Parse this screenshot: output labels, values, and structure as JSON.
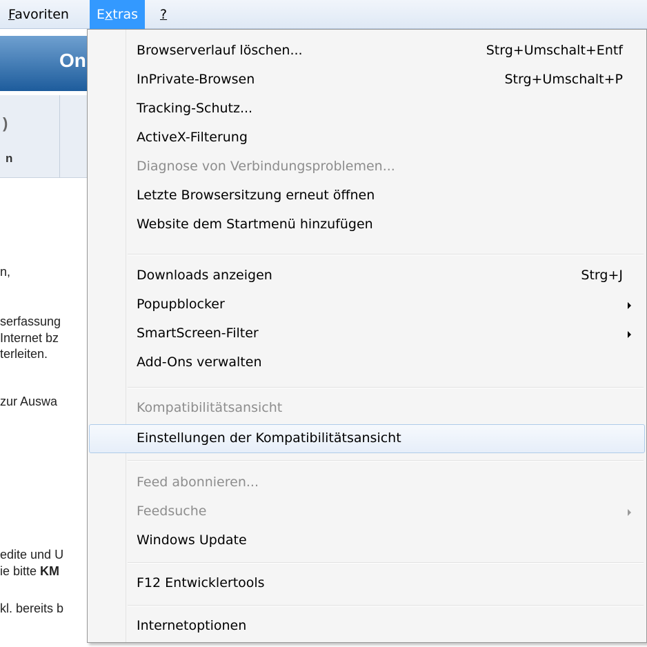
{
  "menubar": {
    "items": [
      {
        "label_pre": "",
        "label_u": "F",
        "label_post": "avoriten"
      },
      {
        "label_pre": "E",
        "label_u": "x",
        "label_post": "tras"
      },
      {
        "label_pre": "",
        "label_u": "?",
        "label_post": ""
      }
    ]
  },
  "background": {
    "banner_text": "On",
    "tab_text_1": ")",
    "tab_text_2": "n",
    "lines": [
      "n,",
      "serfassung",
      " Internet bz",
      "terleiten.",
      " zur Auswa",
      "edite und U",
      "ie bitte ",
      "KM",
      "kl. bereits b"
    ]
  },
  "menu": {
    "items": [
      {
        "label": "Browserverlauf löschen...",
        "shortcut": "Strg+Umschalt+Entf"
      },
      {
        "label": "InPrivate-Browsen",
        "shortcut": "Strg+Umschalt+P"
      },
      {
        "label": "Tracking-Schutz..."
      },
      {
        "label": "ActiveX-Filterung"
      },
      {
        "label": "Diagnose von Verbindungsproblemen...",
        "disabled": true
      },
      {
        "label": "Letzte Browsersitzung erneut öffnen"
      },
      {
        "label": "Website dem Startmenü hinzufügen"
      },
      {
        "label": "Downloads anzeigen",
        "shortcut": "Strg+J"
      },
      {
        "label": "Popupblocker",
        "submenu": true
      },
      {
        "label": "SmartScreen-Filter",
        "submenu": true
      },
      {
        "label": "Add-Ons verwalten"
      },
      {
        "label": "Kompatibilitätsansicht",
        "disabled": true
      },
      {
        "label": "Einstellungen der Kompatibilitätsansicht",
        "highlighted": true
      },
      {
        "label": "Feed abonnieren...",
        "disabled": true
      },
      {
        "label": "Feedsuche",
        "disabled": true,
        "submenu": true
      },
      {
        "label": "Windows Update"
      },
      {
        "label": "F12 Entwicklertools"
      },
      {
        "label": "Internetoptionen"
      }
    ]
  }
}
